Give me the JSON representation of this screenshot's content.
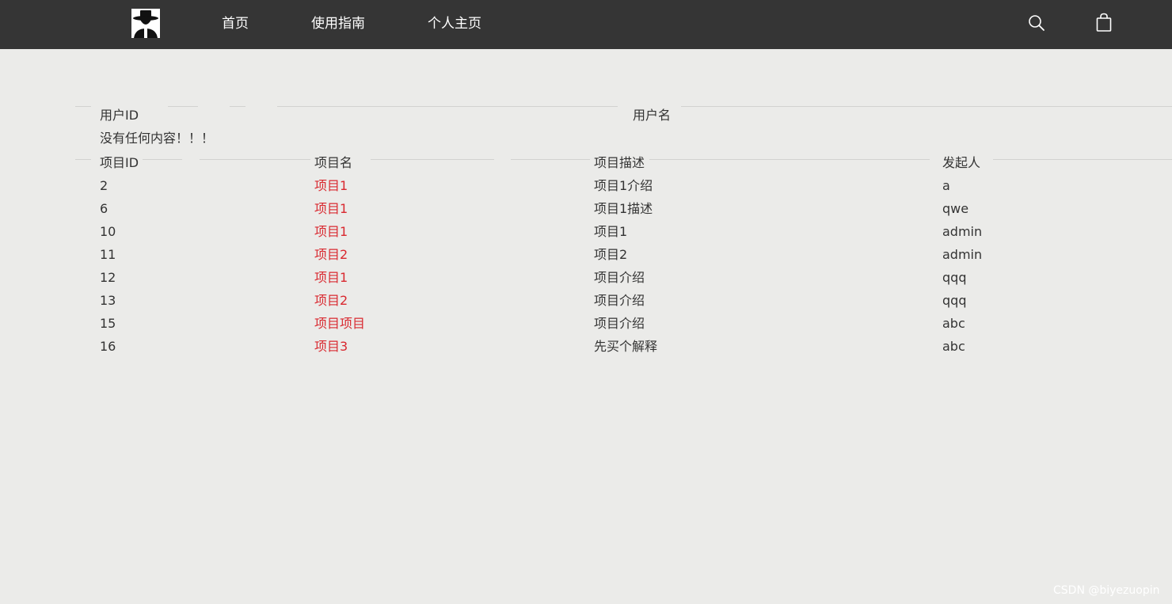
{
  "nav": {
    "links": [
      "首页",
      "使用指南",
      "个人主页"
    ]
  },
  "user_table": {
    "headers": [
      "用户ID",
      "用户名"
    ],
    "empty_message": "没有任何内容！！！"
  },
  "project_table": {
    "headers": [
      "项目ID",
      "项目名",
      "项目描述",
      "发起人"
    ],
    "rows": [
      [
        "2",
        "项目1",
        "项目1介绍",
        "a"
      ],
      [
        "6",
        "项目1",
        "项目1描述",
        "qwe"
      ],
      [
        "10",
        "项目1",
        "项目1",
        "admin"
      ],
      [
        "11",
        "项目2",
        "项目2",
        "admin"
      ],
      [
        "12",
        "项目1",
        "项目介绍",
        "qqq"
      ],
      [
        "13",
        "项目2",
        "项目介绍",
        "qqq"
      ],
      [
        "15",
        "项目项目",
        "项目介绍",
        "abc"
      ],
      [
        "16",
        "项目3",
        "先买个解释",
        "abc"
      ]
    ]
  },
  "watermark": "CSDN @biyezuopin",
  "colors": {
    "navbar": "#353535",
    "background": "#ebebe9",
    "link": "#d9282f",
    "text": "#333333"
  },
  "icons": {
    "logo": "hat-person-logo",
    "search": "search-icon",
    "bag": "shopping-bag-icon"
  }
}
